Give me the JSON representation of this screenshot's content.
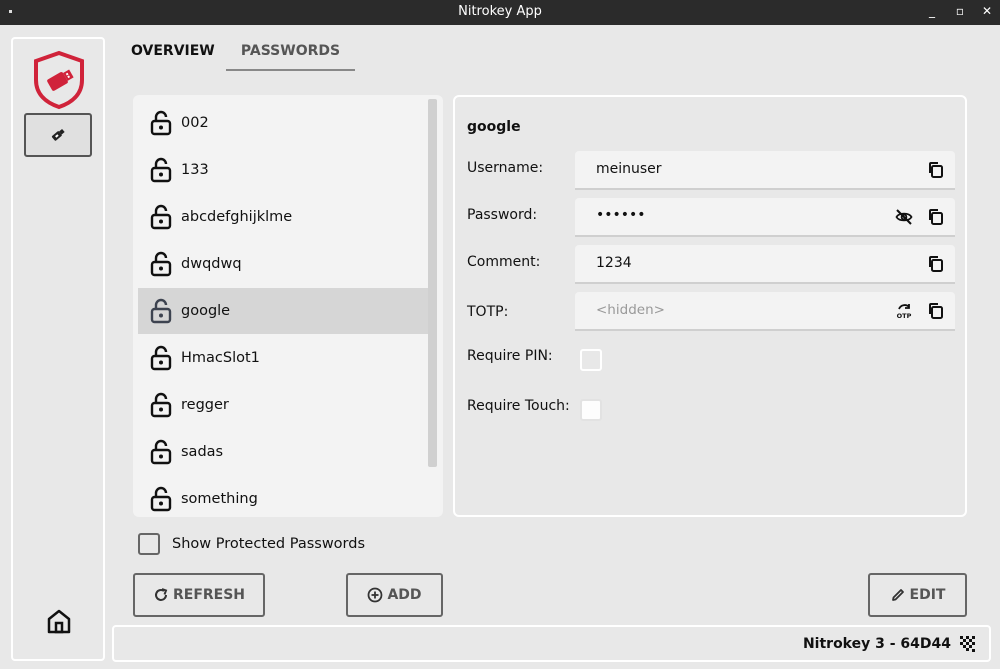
{
  "window": {
    "title": "Nitrokey App",
    "minimize": "_",
    "maximize": "▫",
    "close": "✕"
  },
  "tabs": [
    {
      "label": "OVERVIEW",
      "active": false
    },
    {
      "label": "PASSWORDS",
      "active": true
    }
  ],
  "list": {
    "items": [
      {
        "label": "002",
        "selected": false
      },
      {
        "label": "133",
        "selected": false
      },
      {
        "label": "abcdefghijklme",
        "selected": false
      },
      {
        "label": "dwqdwq",
        "selected": false
      },
      {
        "label": "google",
        "selected": true
      },
      {
        "label": "HmacSlot1",
        "selected": false
      },
      {
        "label": "regger",
        "selected": false
      },
      {
        "label": "sadas",
        "selected": false
      },
      {
        "label": "something",
        "selected": false
      }
    ]
  },
  "detail": {
    "title": "google",
    "username": {
      "label": "Username:",
      "value": "meinuser"
    },
    "password": {
      "label": "Password:",
      "value": "••••••"
    },
    "comment": {
      "label": "Comment:",
      "value": "1234"
    },
    "totp": {
      "label": "TOTP:",
      "placeholder": "<hidden>"
    },
    "require_pin": {
      "label": "Require PIN:",
      "checked": false
    },
    "require_touch": {
      "label": "Require Touch:",
      "checked": false
    }
  },
  "show_protected": {
    "label": "Show Protected Passwords",
    "checked": false
  },
  "buttons": {
    "refresh": "REFRESH",
    "add": "ADD",
    "edit": "EDIT"
  },
  "status": {
    "device": "Nitrokey 3 - 64D44"
  },
  "colors": {
    "brand_red": "#d0233a",
    "selected_row": "#d6d6d6",
    "titlebar": "#2b2b2b"
  }
}
